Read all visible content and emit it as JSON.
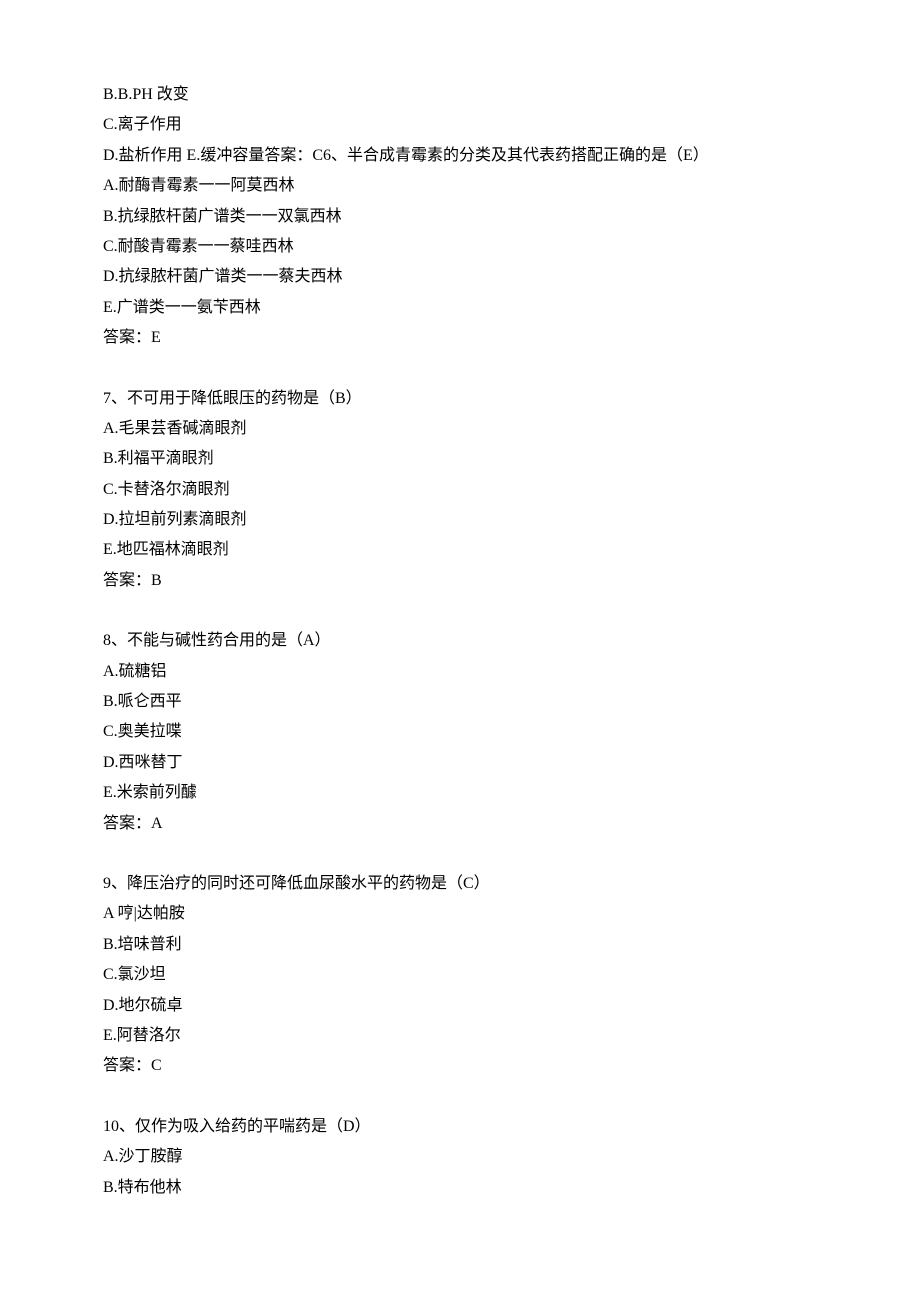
{
  "lines": [
    "B.B.PH 改变",
    "C.离子作用",
    "D.盐析作用 E.缓冲容量答案：C6、半合成青霉素的分类及其代表药搭配正确的是（E）",
    "A.耐酶青霉素一一阿莫西林",
    "B.抗绿脓杆菌广谱类一一双氯西林",
    "C.耐酸青霉素一一蔡哇西林",
    "D.抗绿脓杆菌广谱类一一蔡夫西林",
    "E.广谱类一一氨苄西林",
    "答案：E",
    "",
    "7、不可用于降低眼压的药物是（B）",
    "A.毛果芸香碱滴眼剂",
    "B.利福平滴眼剂",
    "C.卡替洛尔滴眼剂",
    "D.拉坦前列素滴眼剂",
    "E.地匹福林滴眼剂",
    "答案：B",
    "",
    "8、不能与碱性药合用的是（A）",
    "A.硫糖铝",
    "B.哌仑西平",
    "C.奥美拉喋",
    "D.西咪替丁",
    "E.米索前列醵",
    "答案：A",
    "",
    "9、降压治疗的同时还可降低血尿酸水平的药物是（C）",
    "A 哼|达帕胺",
    "B.培味普利",
    "C.氯沙坦",
    "D.地尔硫卓",
    "E.阿替洛尔",
    "答案：C",
    "",
    "10、仅作为吸入给药的平喘药是（D）",
    "A.沙丁胺醇",
    "B.特布他林"
  ]
}
